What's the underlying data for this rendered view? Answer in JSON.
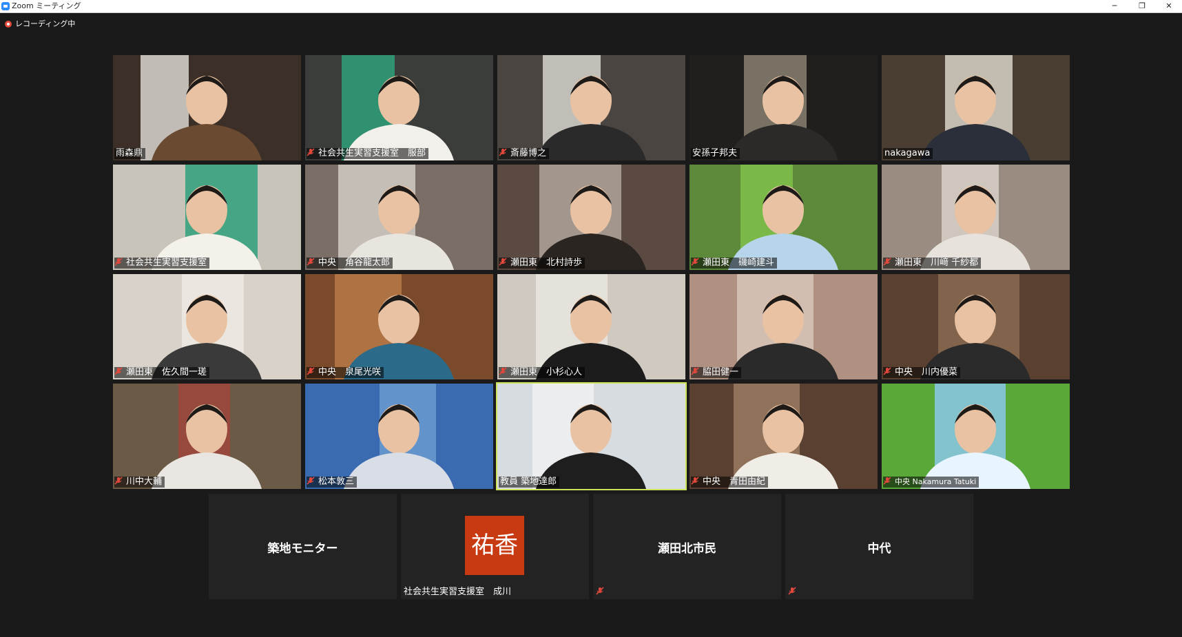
{
  "window": {
    "title": "Zoom ミーティング",
    "minimize": "─",
    "restore": "❐",
    "close": "✕"
  },
  "recording": {
    "label": "レコーディング中"
  },
  "colors": {
    "active_speaker_border": "#cde35a",
    "mute_icon": "#e0483c",
    "avatar_bg": "#c83a12",
    "background": "#1a1a1a"
  },
  "participants": [
    {
      "name": "雨森鼎",
      "muted": false
    },
    {
      "name": "社会共生実習支援室　服部",
      "muted": true
    },
    {
      "name": "斎藤博之",
      "muted": true
    },
    {
      "name": "安孫子邦夫",
      "muted": false
    },
    {
      "name": "nakagawa",
      "muted": false
    },
    {
      "name": "社会共生実習支援室",
      "muted": true
    },
    {
      "name": "中央　角谷龍太郎",
      "muted": true
    },
    {
      "name": "瀬田東　北村詩歩",
      "muted": true
    },
    {
      "name": "瀬田東　磯崎建斗",
      "muted": true
    },
    {
      "name": "瀬田東　川﨑 千紗都",
      "muted": true
    },
    {
      "name": "瀬田東　佐久間一瑳",
      "muted": true
    },
    {
      "name": "中央　泉尾光咲",
      "muted": true
    },
    {
      "name": "瀬田東　小杉心人",
      "muted": true
    },
    {
      "name": "脇田健一",
      "muted": true
    },
    {
      "name": "中央　川内優菜",
      "muted": true
    },
    {
      "name": "川中大輔",
      "muted": true
    },
    {
      "name": "松本敦三",
      "muted": true
    },
    {
      "name": "教員 築地達郎",
      "muted": false,
      "active": true
    },
    {
      "name": "中央　青田由紀",
      "muted": true
    },
    {
      "name": "中央 Nakamura Tatuki",
      "muted": true
    }
  ],
  "video_off_participants": [
    {
      "display": "築地モニター",
      "tag": "",
      "muted": false
    },
    {
      "avatar_text": "祐香",
      "tag": "社会共生実習支援室　成川",
      "muted": false
    },
    {
      "display": "瀬田北市民",
      "tag": "",
      "muted": true
    },
    {
      "display": "中代",
      "tag": "",
      "muted": true
    }
  ]
}
